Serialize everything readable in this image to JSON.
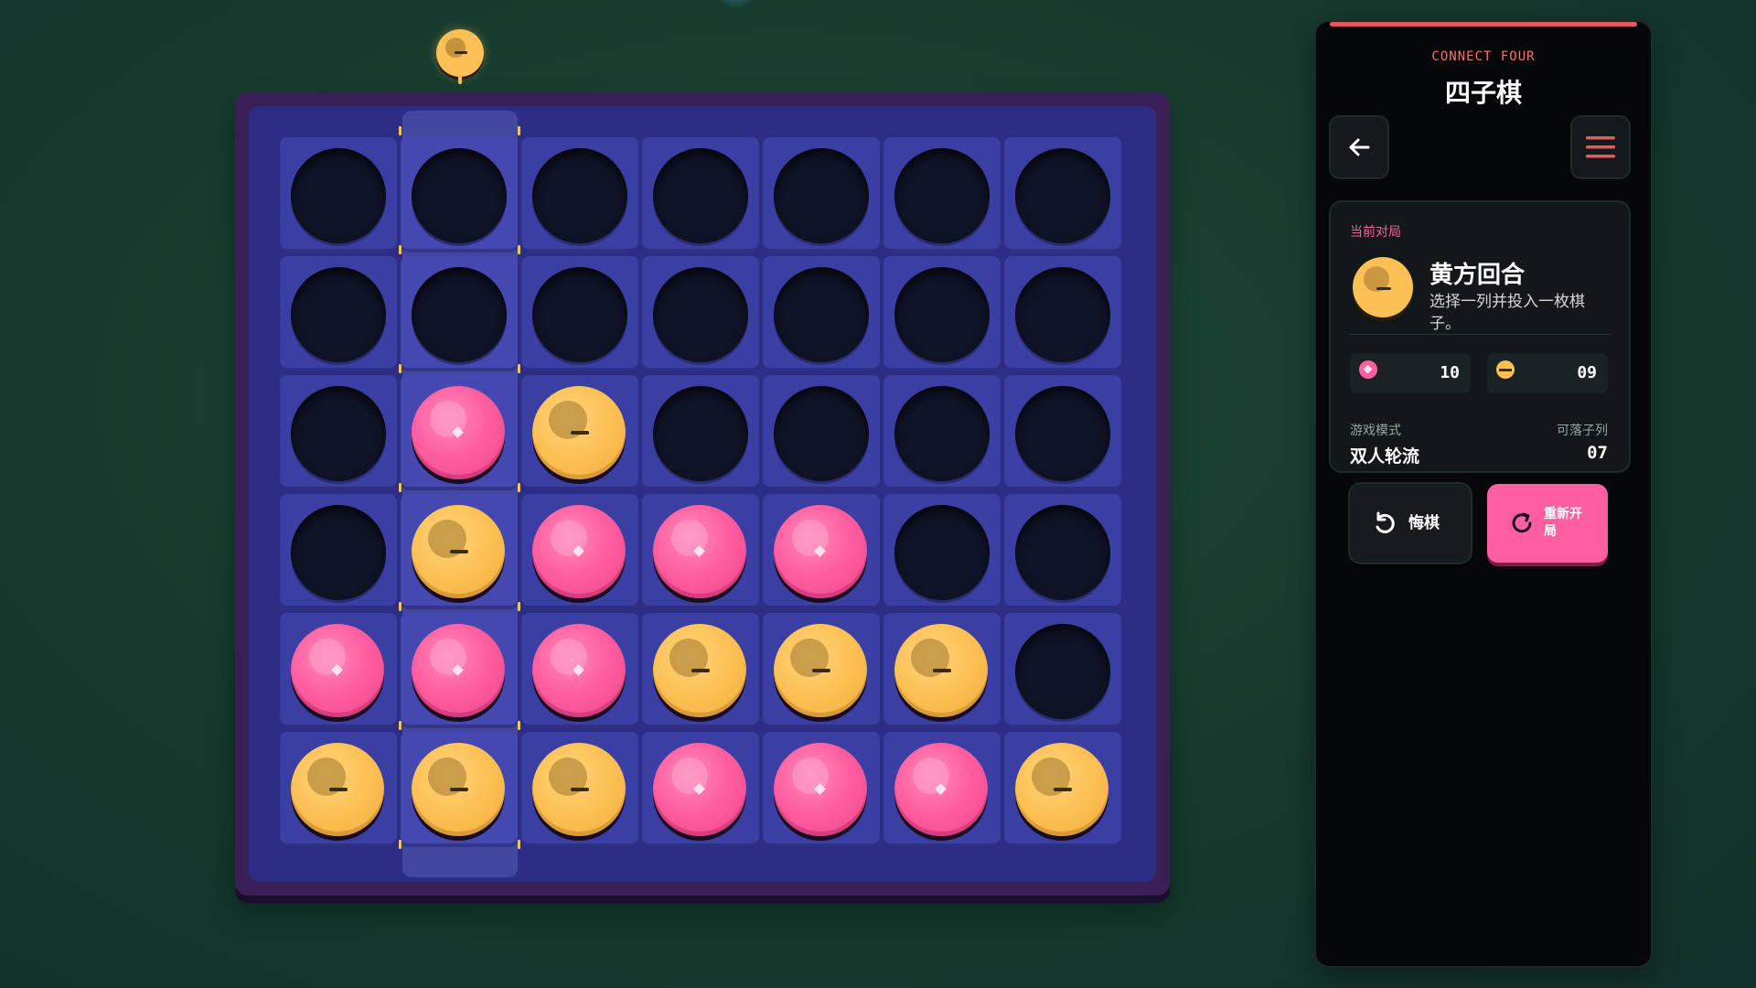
{
  "panel": {
    "subtitle": "CONNECT FOUR",
    "title": "四子棋",
    "back_icon": "arrow-left-icon",
    "menu_icon": "hamburger-menu-icon",
    "accent_color": "#e35a5a"
  },
  "status": {
    "label": "当前对局",
    "turn_title": "黄方回合",
    "turn_desc": "选择一列并投入一枚棋子。",
    "current_player": "yellow"
  },
  "scores": {
    "pink": "10",
    "yellow": "09"
  },
  "meta": {
    "mode_label": "游戏模式",
    "mode_value": "双人轮流",
    "cols_label": "可落子列",
    "cols_value": "07"
  },
  "actions": {
    "undo_label": "悔棋",
    "restart_label": "重新开局"
  },
  "colors": {
    "pink": "#ff5fa0",
    "yellow": "#fcc054",
    "board": "#2c2d85",
    "background": "#163a2d"
  },
  "board": {
    "columns": 7,
    "rows": 6,
    "hover_column": 2,
    "cells": [
      [
        "empty",
        "empty",
        "empty",
        "empty",
        "empty",
        "empty",
        "empty"
      ],
      [
        "empty",
        "empty",
        "empty",
        "empty",
        "empty",
        "empty",
        "empty"
      ],
      [
        "empty",
        "pink",
        "yellow",
        "empty",
        "empty",
        "empty",
        "empty"
      ],
      [
        "empty",
        "yellow",
        "pink",
        "pink",
        "pink",
        "empty",
        "empty"
      ],
      [
        "pink",
        "pink",
        "pink",
        "yellow",
        "yellow",
        "yellow",
        "empty"
      ],
      [
        "yellow",
        "yellow",
        "yellow",
        "pink",
        "pink",
        "pink",
        "yellow"
      ]
    ]
  }
}
